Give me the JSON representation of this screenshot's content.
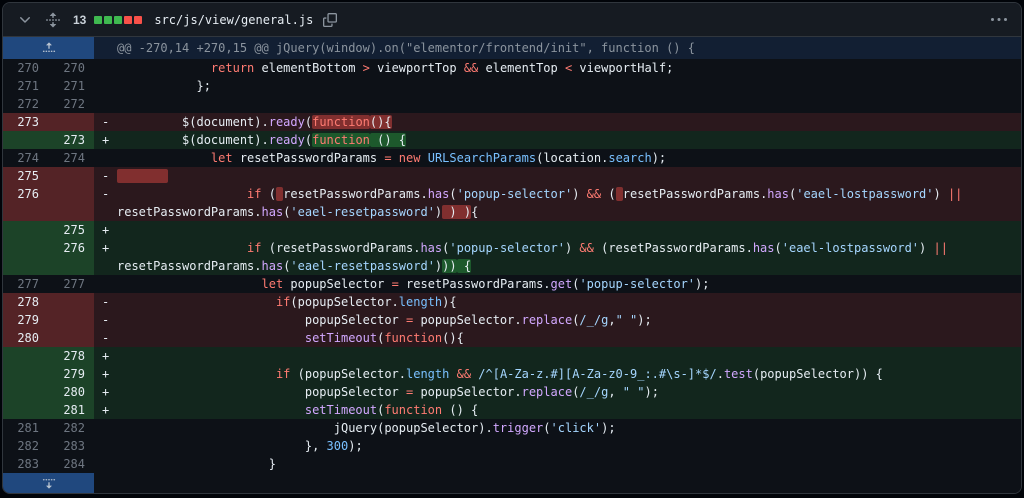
{
  "header": {
    "changes_count": "13",
    "diffstat": {
      "added_blocks": 3,
      "removed_blocks": 2
    },
    "file_path": "src/js/view/general.js",
    "icons": {
      "collapse": "chevron-down",
      "expand_all": "unfold",
      "copy": "copy",
      "options": "kebab-horizontal"
    }
  },
  "hunk_header": "@@ -270,14 +270,15 @@ jQuery(window).on(\"elementor/frontend/init\", function () {",
  "colors": {
    "addition_green": "#3fb950",
    "deletion_red": "#f85149",
    "expand_blue": "#388bfd",
    "background": "#0d1117",
    "header_background": "#161b22"
  },
  "diff_lines": [
    {
      "type": "context",
      "old": "270",
      "new": "270",
      "sign": "",
      "segs": [
        [
          "             ",
          "d"
        ],
        [
          "return",
          "k"
        ],
        [
          " elementBottom ",
          "d"
        ],
        [
          ">",
          "k"
        ],
        [
          " viewportTop ",
          "d"
        ],
        [
          "&&",
          "k"
        ],
        [
          " elementTop ",
          "d"
        ],
        [
          "<",
          "k"
        ],
        [
          " viewportHalf;",
          "d"
        ]
      ]
    },
    {
      "type": "context",
      "old": "271",
      "new": "271",
      "sign": "",
      "segs": [
        [
          "           };",
          "d"
        ]
      ]
    },
    {
      "type": "context",
      "old": "272",
      "new": "272",
      "sign": "",
      "segs": []
    },
    {
      "type": "del",
      "old": "273",
      "new": "",
      "sign": "-",
      "segs": [
        [
          "         $(document).",
          "d"
        ],
        [
          "ready",
          "f"
        ],
        [
          "(",
          "d"
        ],
        [
          "function",
          "k",
          "h"
        ],
        [
          "(){",
          "d",
          "h"
        ]
      ]
    },
    {
      "type": "add",
      "old": "",
      "new": "273",
      "sign": "+",
      "segs": [
        [
          "         $(document).",
          "d"
        ],
        [
          "ready",
          "f"
        ],
        [
          "(",
          "d"
        ],
        [
          "function",
          "k",
          "h"
        ],
        [
          " () {",
          "d",
          "h"
        ]
      ]
    },
    {
      "type": "context",
      "old": "274",
      "new": "274",
      "sign": "",
      "segs": [
        [
          "             ",
          "d"
        ],
        [
          "let",
          "k"
        ],
        [
          " resetPasswordParams ",
          "d"
        ],
        [
          "=",
          "k"
        ],
        [
          " ",
          "d"
        ],
        [
          "new",
          "k"
        ],
        [
          " ",
          "d"
        ],
        [
          "URLSearchParams",
          "c"
        ],
        [
          "(location.",
          "d"
        ],
        [
          "search",
          "c"
        ],
        [
          ");",
          "d"
        ]
      ]
    },
    {
      "type": "del",
      "old": "275",
      "new": "",
      "sign": "-",
      "segs": [
        [
          "       ",
          "d",
          "h"
        ]
      ]
    },
    {
      "type": "del",
      "old": "276",
      "new": "",
      "sign": "-",
      "segs": [
        [
          "                  ",
          "d"
        ],
        [
          "if",
          "k"
        ],
        [
          " (",
          "d"
        ],
        [
          " ",
          "d",
          "h"
        ],
        [
          "resetPasswordParams.",
          "d"
        ],
        [
          "has",
          "f"
        ],
        [
          "(",
          "d"
        ],
        [
          "'popup-selector'",
          "s"
        ],
        [
          ") ",
          "d"
        ],
        [
          "&&",
          "k"
        ],
        [
          " (",
          "d"
        ],
        [
          " ",
          "d",
          "h"
        ],
        [
          "resetPasswordParams.",
          "d"
        ],
        [
          "has",
          "f"
        ],
        [
          "(",
          "d"
        ],
        [
          "'eael-lostpassword'",
          "s"
        ],
        [
          ") ",
          "d"
        ],
        [
          "||",
          "k"
        ],
        [
          " ",
          "d"
        ],
        [
          "resetPasswordParams.",
          "d"
        ],
        [
          "has",
          "f"
        ],
        [
          "(",
          "d"
        ],
        [
          "'eael-resetpassword'",
          "s"
        ],
        [
          ")",
          "d"
        ],
        [
          " ) )",
          "d",
          "h"
        ],
        [
          "{",
          "d"
        ]
      ]
    },
    {
      "type": "add",
      "old": "",
      "new": "275",
      "sign": "+",
      "segs": []
    },
    {
      "type": "add",
      "old": "",
      "new": "276",
      "sign": "+",
      "segs": [
        [
          "                  ",
          "d"
        ],
        [
          "if",
          "k"
        ],
        [
          " (resetPasswordParams.",
          "d"
        ],
        [
          "has",
          "f"
        ],
        [
          "(",
          "d"
        ],
        [
          "'popup-selector'",
          "s"
        ],
        [
          ") ",
          "d"
        ],
        [
          "&&",
          "k"
        ],
        [
          " (resetPasswordParams.",
          "d"
        ],
        [
          "has",
          "f"
        ],
        [
          "(",
          "d"
        ],
        [
          "'eael-lostpassword'",
          "s"
        ],
        [
          ") ",
          "d"
        ],
        [
          "||",
          "k"
        ],
        [
          " ",
          "d"
        ],
        [
          "resetPasswordParams.",
          "d"
        ],
        [
          "has",
          "f"
        ],
        [
          "(",
          "d"
        ],
        [
          "'eael-resetpassword'",
          "s"
        ],
        [
          ")",
          "d"
        ],
        [
          "))",
          "d",
          "h"
        ],
        [
          " {",
          "d",
          "h"
        ]
      ]
    },
    {
      "type": "context",
      "old": "277",
      "new": "277",
      "sign": "",
      "segs": [
        [
          "                    ",
          "d"
        ],
        [
          "let",
          "k"
        ],
        [
          " popupSelector ",
          "d"
        ],
        [
          "=",
          "k"
        ],
        [
          " resetPasswordParams.",
          "d"
        ],
        [
          "get",
          "f"
        ],
        [
          "(",
          "d"
        ],
        [
          "'popup-selector'",
          "s"
        ],
        [
          ");",
          "d"
        ]
      ]
    },
    {
      "type": "del",
      "old": "278",
      "new": "",
      "sign": "-",
      "segs": [
        [
          "                      ",
          "d"
        ],
        [
          "if",
          "k"
        ],
        [
          "(popupSelector.",
          "d"
        ],
        [
          "length",
          "c"
        ],
        [
          "){",
          "d"
        ]
      ]
    },
    {
      "type": "del",
      "old": "279",
      "new": "",
      "sign": "-",
      "segs": [
        [
          "                          popupSelector ",
          "d"
        ],
        [
          "=",
          "k"
        ],
        [
          " popupSelector.",
          "d"
        ],
        [
          "replace",
          "f"
        ],
        [
          "(",
          "d"
        ],
        [
          "/_/g",
          "s"
        ],
        [
          ",",
          "d"
        ],
        [
          "\" \"",
          "s"
        ],
        [
          ");",
          "d"
        ]
      ]
    },
    {
      "type": "del",
      "old": "280",
      "new": "",
      "sign": "-",
      "segs": [
        [
          "                          ",
          "d"
        ],
        [
          "setTimeout",
          "f"
        ],
        [
          "(",
          "d"
        ],
        [
          "function",
          "k"
        ],
        [
          "(){",
          "d"
        ]
      ]
    },
    {
      "type": "add",
      "old": "",
      "new": "278",
      "sign": "+",
      "segs": []
    },
    {
      "type": "add",
      "old": "",
      "new": "279",
      "sign": "+",
      "segs": [
        [
          "                      ",
          "d"
        ],
        [
          "if",
          "k"
        ],
        [
          " (popupSelector.",
          "d"
        ],
        [
          "length",
          "c"
        ],
        [
          " ",
          "d"
        ],
        [
          "&&",
          "k"
        ],
        [
          " ",
          "d"
        ],
        [
          "/^[A-Za-z.#][A-Za-z0-9_:.#\\s-]*$/",
          "s"
        ],
        [
          ".",
          "d"
        ],
        [
          "test",
          "f"
        ],
        [
          "(popupSelector)) {",
          "d"
        ]
      ]
    },
    {
      "type": "add",
      "old": "",
      "new": "280",
      "sign": "+",
      "segs": [
        [
          "                          popupSelector ",
          "d"
        ],
        [
          "=",
          "k"
        ],
        [
          " popupSelector.",
          "d"
        ],
        [
          "replace",
          "f"
        ],
        [
          "(",
          "d"
        ],
        [
          "/_/g",
          "s"
        ],
        [
          ", ",
          "d"
        ],
        [
          "\" \"",
          "s"
        ],
        [
          ");",
          "d"
        ]
      ]
    },
    {
      "type": "add",
      "old": "",
      "new": "281",
      "sign": "+",
      "segs": [
        [
          "                          ",
          "d"
        ],
        [
          "setTimeout",
          "f"
        ],
        [
          "(",
          "d"
        ],
        [
          "function",
          "k"
        ],
        [
          " () {",
          "d"
        ]
      ]
    },
    {
      "type": "context",
      "old": "281",
      "new": "282",
      "sign": "",
      "segs": [
        [
          "                              jQuery(popupSelector).",
          "d"
        ],
        [
          "trigger",
          "f"
        ],
        [
          "(",
          "d"
        ],
        [
          "'click'",
          "s"
        ],
        [
          ");",
          "d"
        ]
      ]
    },
    {
      "type": "context",
      "old": "282",
      "new": "283",
      "sign": "",
      "segs": [
        [
          "                          }, ",
          "d"
        ],
        [
          "300",
          "c"
        ],
        [
          ");",
          "d"
        ]
      ]
    },
    {
      "type": "context",
      "old": "283",
      "new": "284",
      "sign": "",
      "segs": [
        [
          "                     }",
          "d"
        ]
      ]
    }
  ]
}
